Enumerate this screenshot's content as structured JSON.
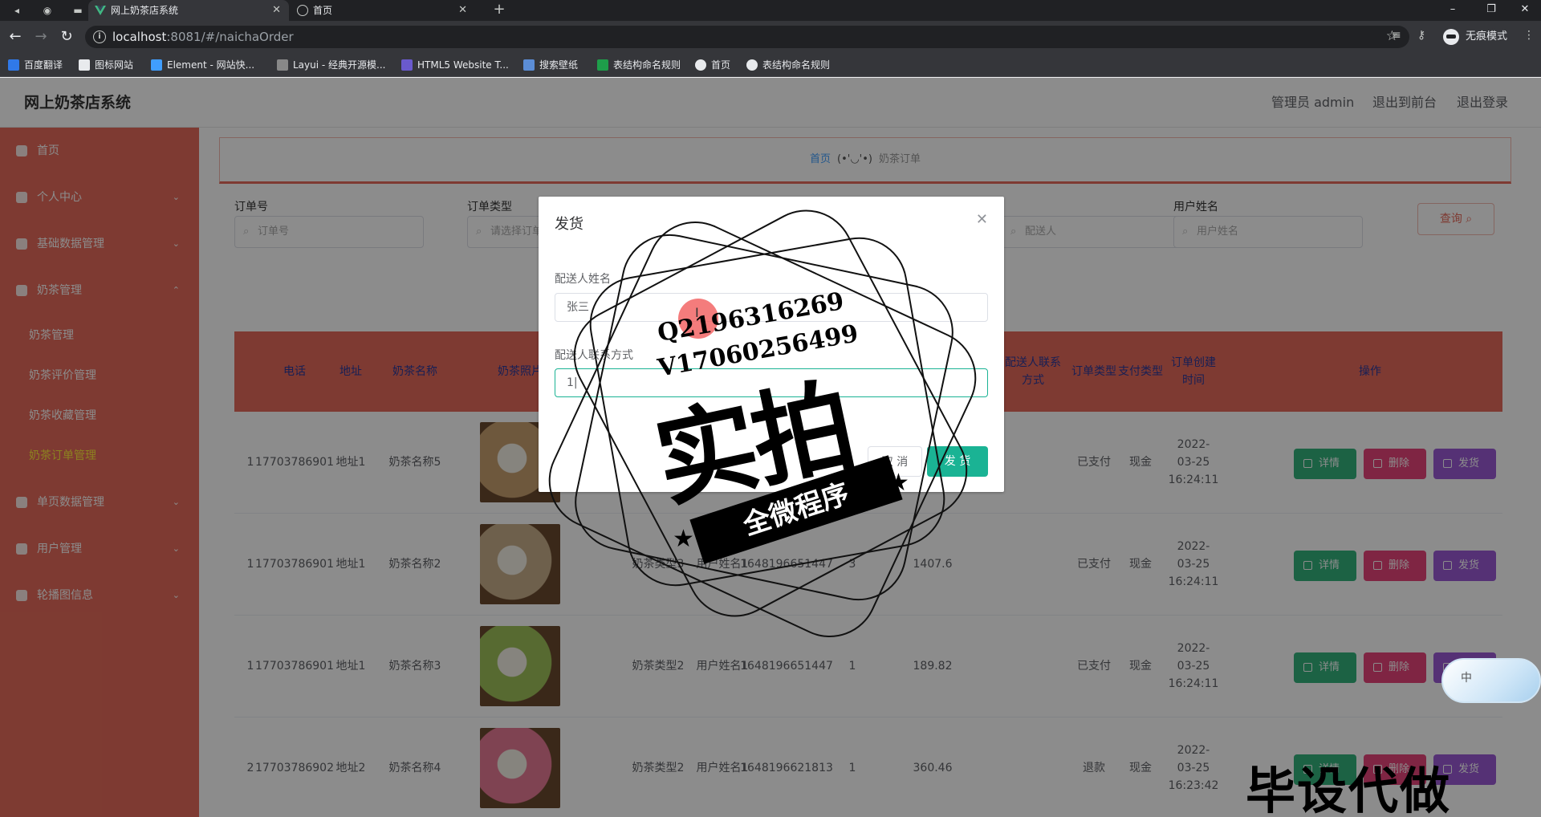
{
  "browser": {
    "tabs": [
      {
        "title": "网上奶茶店系统",
        "active": true
      },
      {
        "title": "首页",
        "active": false
      }
    ],
    "url_host": "localhost",
    "url_rest": ":8081/#/naichaOrder",
    "incognito_label": "无痕模式",
    "bookmarks": [
      "百度翻译",
      "图标网站",
      "Element - 网站快...",
      "Layui - 经典开源模...",
      "HTML5 Website T...",
      "搜索壁纸",
      "表结构命名规则",
      "首页",
      "表结构命名规则"
    ]
  },
  "header": {
    "title": "网上奶茶店系统",
    "admin": "管理员 admin",
    "to_front": "退出到前台",
    "logout": "退出登录"
  },
  "sidebar": {
    "items": [
      {
        "label": "首页"
      },
      {
        "label": "个人中心"
      },
      {
        "label": "基础数据管理"
      },
      {
        "label": "奶茶管理"
      },
      {
        "label": "单页数据管理"
      },
      {
        "label": "用户管理"
      },
      {
        "label": "轮播图信息"
      }
    ],
    "sub_items": [
      "奶茶管理",
      "奶茶评价管理",
      "奶茶收藏管理",
      "奶茶订单管理"
    ]
  },
  "breadcrumb": {
    "home": "首页",
    "sep": "(•'◡'•)",
    "current": "奶茶订单"
  },
  "search": {
    "order_no_label": "订单号",
    "order_no_placeholder": "订单号",
    "order_type_label": "订单类型",
    "order_type_placeholder": "请选择订单类型",
    "user_name_label": "用户姓名",
    "user_name_placeholder": "用户姓名",
    "hidden_placeholder": "配送人",
    "query_label": "查询"
  },
  "table": {
    "headers": {
      "phone": "电话",
      "address": "地址",
      "tea_name": "奶茶名称",
      "tea_photo": "奶茶照片",
      "courier_contact": "配送人联系方式",
      "order_type": "订单类型",
      "pay_type": "支付类型",
      "create_time": "订单创建时间",
      "action": "操作"
    },
    "rows": [
      {
        "no": "1",
        "phone": "17703786901",
        "address": "地址1",
        "tea_name": "奶茶名称5",
        "tea_type": "",
        "user_name": "",
        "order_id": "",
        "qty": "",
        "price": "",
        "order_type": "已支付",
        "pay_type": "现金",
        "time": "2022-03-25 16:24:11",
        "color": "#c8a070"
      },
      {
        "no": "1",
        "phone": "17703786901",
        "address": "地址1",
        "tea_name": "奶茶名称2",
        "tea_type": "奶茶类型3",
        "user_name": "用户姓名1",
        "order_id": "1648196651447",
        "qty": "3",
        "price": "1407.6",
        "order_type": "已支付",
        "pay_type": "现金",
        "time": "2022-03-25 16:24:11",
        "color": "#c9b08a"
      },
      {
        "no": "1",
        "phone": "17703786901",
        "address": "地址1",
        "tea_name": "奶茶名称3",
        "tea_type": "奶茶类型2",
        "user_name": "用户姓名1",
        "order_id": "1648196651447",
        "qty": "1",
        "price": "189.82",
        "order_type": "已支付",
        "pay_type": "现金",
        "time": "2022-03-25 16:24:11",
        "color": "#9ec25a"
      },
      {
        "no": "2",
        "phone": "17703786902",
        "address": "地址2",
        "tea_name": "奶茶名称4",
        "tea_type": "奶茶类型2",
        "user_name": "用户姓名1",
        "order_id": "1648196621813",
        "qty": "1",
        "price": "360.46",
        "order_type": "退款",
        "pay_type": "现金",
        "time": "2022-03-25 16:23:42",
        "color": "#e87a95"
      }
    ],
    "btn_detail": "详情",
    "btn_delete": "删除",
    "btn_ship": "发货"
  },
  "dialog": {
    "title": "发货",
    "courier_name_label": "配送人姓名",
    "courier_name_value": "张三",
    "courier_phone_label": "配送人联系方式",
    "courier_phone_value": "1|",
    "cancel": "取 消",
    "ok": "发 货"
  },
  "watermark": {
    "qq": "Q2196316269",
    "v": "V17060256499",
    "big": "实拍",
    "ribbon": "全微程序",
    "bottom": "毕设代做"
  },
  "ime": "中",
  "colors": {
    "sidebar": "#e66b5b",
    "primary": "#1ab394",
    "detail": "#34b27d",
    "delete": "#e8447a",
    "ship": "#9b59d6"
  }
}
